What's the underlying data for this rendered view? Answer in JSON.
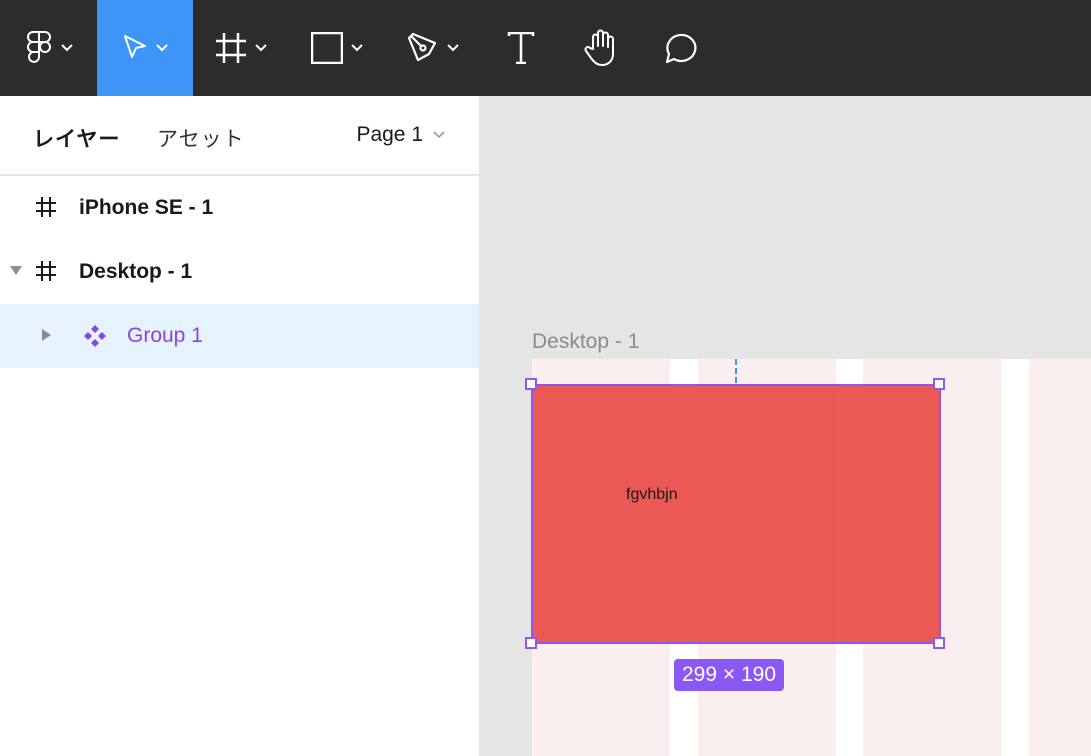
{
  "toolbar": {
    "tools": [
      {
        "name": "main-menu",
        "icon": "figma-logo-icon",
        "has_dropdown": true
      },
      {
        "name": "move",
        "icon": "move-cursor-icon",
        "has_dropdown": true,
        "active": true
      },
      {
        "name": "frame",
        "icon": "frame-icon",
        "has_dropdown": true
      },
      {
        "name": "rectangle",
        "icon": "rectangle-icon",
        "has_dropdown": true
      },
      {
        "name": "pen",
        "icon": "pen-icon",
        "has_dropdown": true
      },
      {
        "name": "text",
        "icon": "text-icon",
        "has_dropdown": false
      },
      {
        "name": "hand",
        "icon": "hand-icon",
        "has_dropdown": false
      },
      {
        "name": "comment",
        "icon": "comment-icon",
        "has_dropdown": false
      }
    ],
    "active_color": "#3d96f7",
    "background": "#2c2c2c"
  },
  "panel": {
    "tabs": {
      "layers": "レイヤー",
      "assets": "アセット"
    },
    "page": "Page 1",
    "layers": [
      {
        "name": "iPhone SE - 1",
        "icon": "frame-icon",
        "expanded": null,
        "selected": false
      },
      {
        "name": "Desktop - 1",
        "icon": "frame-icon",
        "expanded": true,
        "selected": false
      },
      {
        "name": "Group 1",
        "icon": "component-icon",
        "expanded": false,
        "selected": true
      }
    ]
  },
  "canvas": {
    "frame_label": "Desktop - 1",
    "rect_text": "fgvhbjn",
    "size_badge": "299 × 190",
    "rect_color": "#e94843",
    "selection_color": "#8a58f5"
  }
}
